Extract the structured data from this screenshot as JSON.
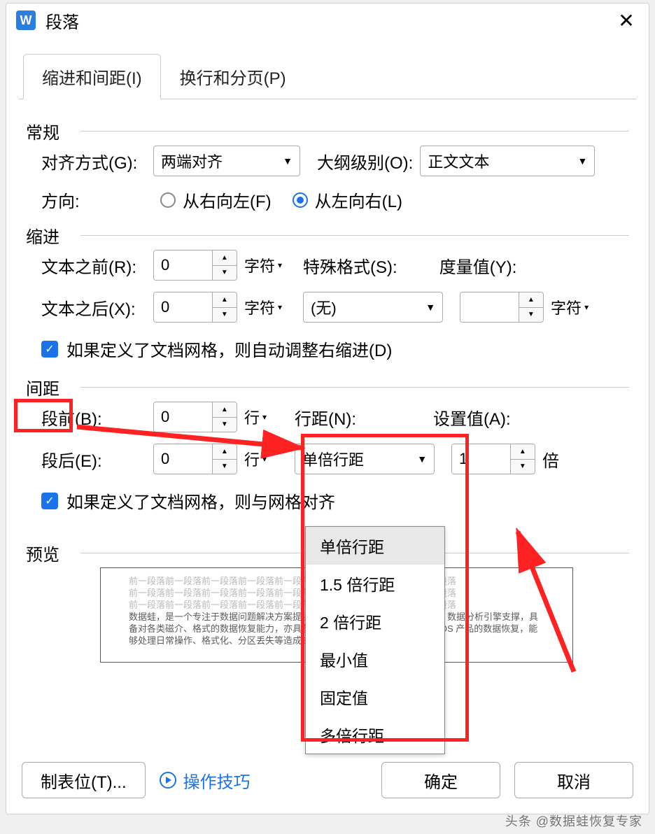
{
  "dialog": {
    "title": "段落",
    "app_icon_letter": "W"
  },
  "tabs": {
    "indent": "缩进和间距(I)",
    "pagebreak": "换行和分页(P)"
  },
  "general": {
    "section": "常规",
    "align_label": "对齐方式(G):",
    "align_value": "两端对齐",
    "outline_label": "大纲级别(O):",
    "outline_value": "正文文本",
    "direction_label": "方向:",
    "rtl_label": "从右向左(F)",
    "ltr_label": "从左向右(L)"
  },
  "indent": {
    "section": "缩进",
    "before_label": "文本之前(R):",
    "before_value": "0",
    "before_unit": "字符",
    "after_label": "文本之后(X):",
    "after_value": "0",
    "after_unit": "字符",
    "special_label": "特殊格式(S):",
    "special_value": "(无)",
    "measure_label": "度量值(Y):",
    "measure_value": "",
    "measure_unit": "字符",
    "checkbox_text": "如果定义了文档网格，则自动调整右缩进(D)"
  },
  "spacing": {
    "section": "间距",
    "before_label": "段前(B):",
    "before_value": "0",
    "before_unit": "行",
    "after_label": "段后(E):",
    "after_value": "0",
    "after_unit": "行",
    "linespacing_label": "行距(N):",
    "linespacing_value": "单倍行距",
    "setvalue_label": "设置值(A):",
    "setvalue_value": "1",
    "setvalue_unit": "倍",
    "checkbox_text": "如果定义了文档网格，则与网格对齐",
    "dropdown_options": [
      "单倍行距",
      "1.5 倍行距",
      "2 倍行距",
      "最小值",
      "固定值",
      "多倍行距"
    ]
  },
  "preview": {
    "section": "预览",
    "placeholder_line": "前一段落前一段落前一段落前一段落前一段落前一段落前一段落前一段落前一段落",
    "body_text": "数据蛙，是一个专注于数据问题解决方案提供商，致力于为用户提供数据恢复、数据分析引擎支撑，具备对各类磁介、格式的数据恢复能力，亦具备较强的逻辑处理能力、支持各类iOS 产品的数据恢复，能够处理日常操作、格式化、分区丢失等造成的数据丢失记录及文档"
  },
  "footer": {
    "tabstop": "制表位(T)...",
    "tips": "操作技巧",
    "ok": "确定",
    "cancel": "取消"
  },
  "watermark": "头条 @数据蛙恢复专家"
}
